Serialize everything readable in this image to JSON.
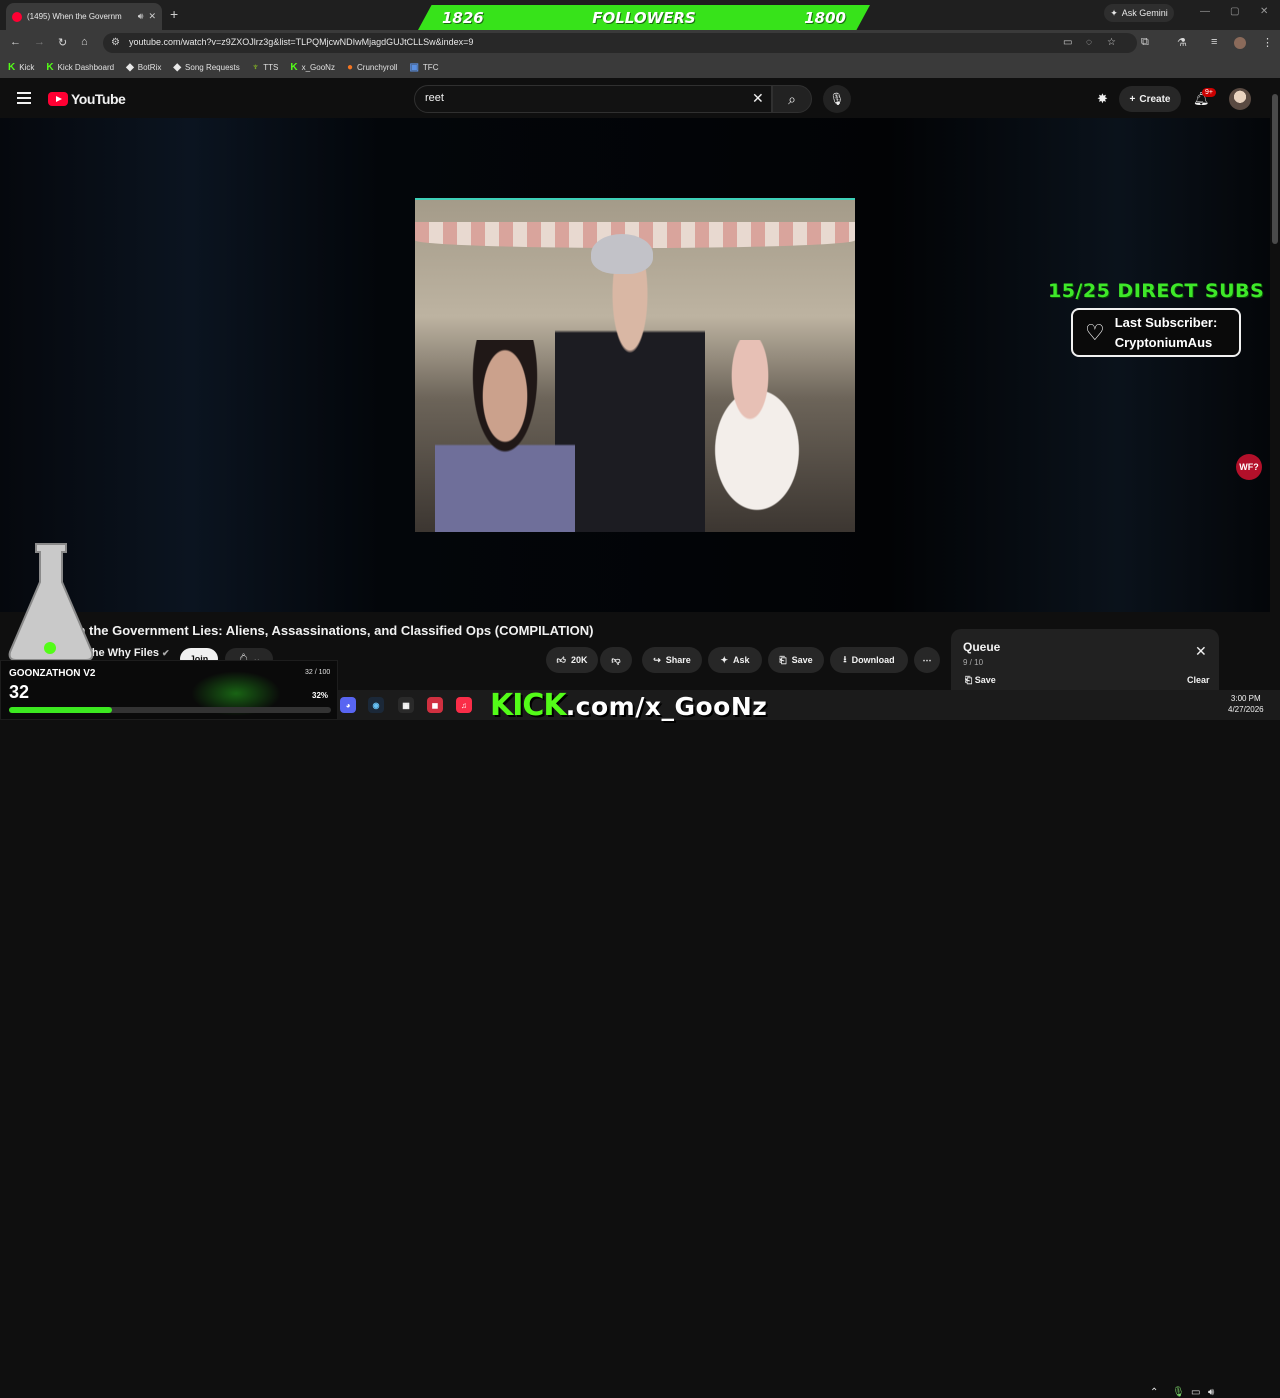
{
  "browser": {
    "tab_title": "(1495) When the Governm",
    "url": "youtube.com/watch?v=z9ZXOJlrz3g&list=TLPQMjcwNDIwMjagdGUJtCLLSw&index=9",
    "ask_gemini": "Ask Gemini",
    "bookmarks": [
      {
        "label": "Kick",
        "icon": "K",
        "color": "#53fc18"
      },
      {
        "label": "Kick Dashboard",
        "icon": "K",
        "color": "#53fc18"
      },
      {
        "label": "BotRix",
        "icon": "◆",
        "color": "#e8e8e8"
      },
      {
        "label": "Song Requests",
        "icon": "◆",
        "color": "#e8e8e8"
      },
      {
        "label": "TTS",
        "icon": "♆",
        "color": "#9fe01c"
      },
      {
        "label": "x_GooNz",
        "icon": "K",
        "color": "#53fc18"
      },
      {
        "label": "Crunchyroll",
        "icon": "●",
        "color": "#f47521"
      },
      {
        "label": "TFC",
        "icon": "▣",
        "color": "#5a8fe0"
      }
    ]
  },
  "followers_overlay": {
    "left_value": "1826",
    "label": "FOLLOWERS",
    "right_value": "1800"
  },
  "youtube": {
    "logo_text": "YouTube",
    "search_value": "reet",
    "create_label": "Create",
    "notif_badge": "9+"
  },
  "overlay": {
    "direct_subs": "15/25 DIRECT SUBS",
    "last_sub_label": "Last Subscriber:",
    "last_sub_name": "CryptoniumAus",
    "wf_badge": "WF?"
  },
  "video": {
    "title": "When the Government Lies: Aliens, Assassinations, and Classified Ops (COMPILATION)",
    "channel": "The Why Files",
    "join_label": "Join",
    "like_count": "20K",
    "share_label": "Share",
    "ask_label": "Ask",
    "save_label": "Save",
    "download_label": "Download"
  },
  "queue": {
    "title": "Queue",
    "position": "9 / 10",
    "save_label": "Save",
    "clear_label": "Clear"
  },
  "goonzathon": {
    "title": "GOONZATHON V2",
    "value": "32",
    "range": "32 / 100",
    "percent_label": "32%",
    "progress": 0.32
  },
  "stream": {
    "kick_prefix": "KICK",
    "url_suffix": ".com/x_GooNz"
  },
  "taskbar": {
    "time": "3:00 PM",
    "date": "4/27/2026"
  },
  "colors": {
    "kick_green": "#53fc18",
    "youtube_red": "#ff0033"
  }
}
